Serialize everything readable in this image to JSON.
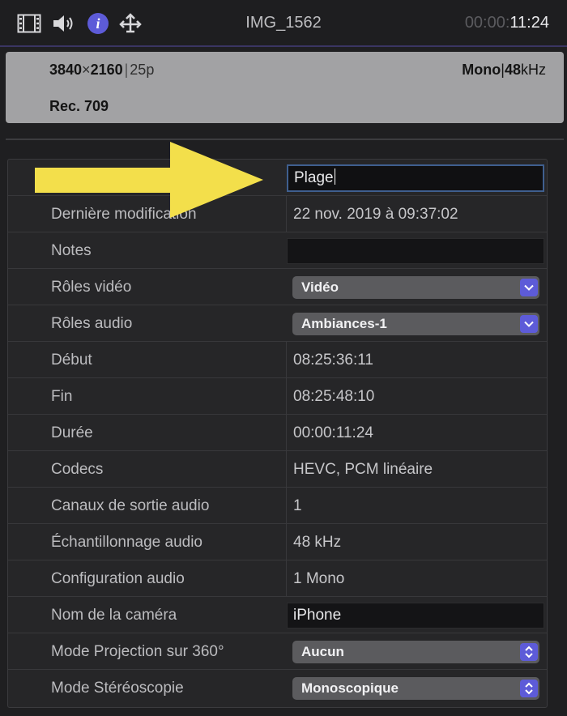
{
  "toolbar": {
    "clip_name": "IMG_1562",
    "timecode_dim": "00:00:",
    "timecode_main": "11:24",
    "icons": [
      "film-icon",
      "speaker-icon",
      "info-icon",
      "share-icon"
    ],
    "accent_color": "#5d5bd8"
  },
  "info": {
    "resolution_w": "3840",
    "resolution_x": "×",
    "resolution_h": "2160",
    "frame_rate": "25p",
    "audio_channels": "Mono",
    "sample_rate_value": "48",
    "sample_rate_unit": "kHz",
    "color_space": "Rec. 709"
  },
  "properties": [
    {
      "label": "",
      "value": "Plage",
      "kind": "text-field-active"
    },
    {
      "label": "Dernière modification",
      "value": "22 nov. 2019 à 09:37:02",
      "kind": "static"
    },
    {
      "label": "Notes",
      "value": "",
      "kind": "text-field"
    },
    {
      "label": "Rôles vidéo",
      "value": "Vidéo",
      "kind": "popup-down"
    },
    {
      "label": "Rôles audio",
      "value": "Ambiances-1",
      "kind": "popup-down"
    },
    {
      "label": "Début",
      "value": "08:25:36:11",
      "kind": "static"
    },
    {
      "label": "Fin",
      "value": "08:25:48:10",
      "kind": "static"
    },
    {
      "label": "Durée",
      "value": "00:00:11:24",
      "kind": "static"
    },
    {
      "label": "Codecs",
      "value": "HEVC, PCM linéaire",
      "kind": "static"
    },
    {
      "label": "Canaux de sortie audio",
      "value": "1",
      "kind": "static"
    },
    {
      "label": "Échantillonnage audio",
      "value": "48 kHz",
      "kind": "static"
    },
    {
      "label": "Configuration audio",
      "value": "1 Mono",
      "kind": "static"
    },
    {
      "label": "Nom de la caméra",
      "value": "iPhone",
      "kind": "text-field"
    },
    {
      "label": "Mode Projection sur 360°",
      "value": "Aucun",
      "kind": "popup-updown"
    },
    {
      "label": "Mode Stéréoscopie",
      "value": "Monoscopique",
      "kind": "popup-updown"
    }
  ]
}
